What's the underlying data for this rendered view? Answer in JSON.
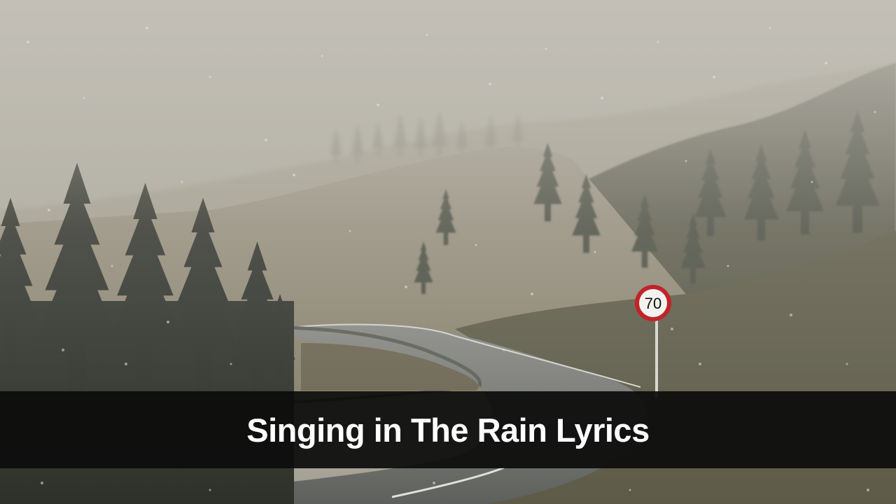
{
  "image": {
    "caption": "Singing in The Rain Lyrics",
    "speed_sign_value": "70"
  },
  "colors": {
    "sky_fog": "#b4b1a7",
    "hill_far": "#a29d8e",
    "meadow": "#8e8673",
    "grass_dark": "#5d5b48",
    "forest_dark": "#2c3029",
    "road": "#757874",
    "caption_bar": "#0c0c0c",
    "caption_text": "#ffffff",
    "sign_red": "#c0242a"
  },
  "icons": {
    "speed_sign": "speed-limit-sign-icon"
  }
}
